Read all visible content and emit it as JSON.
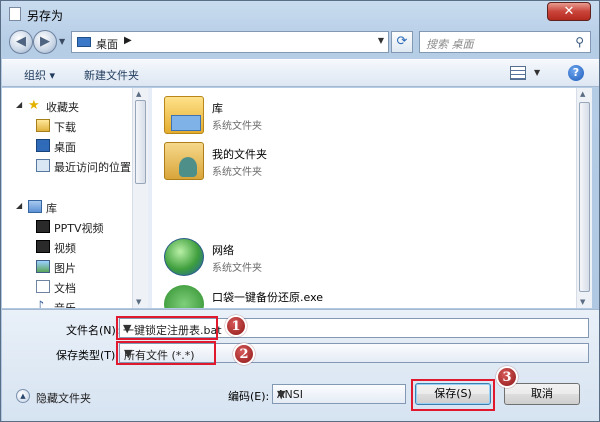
{
  "window": {
    "title": "另存为",
    "close_label": "✕"
  },
  "address": {
    "location": "桌面",
    "chevron": "▶",
    "search_placeholder": "搜索 桌面"
  },
  "toolbar": {
    "organize_label": "组织 ▾",
    "new_folder_label": "新建文件夹",
    "help_label": "?"
  },
  "sidebar": {
    "favorites": {
      "label": "收藏夹",
      "items": [
        {
          "label": "下载",
          "icon": "download-folder-icon"
        },
        {
          "label": "桌面",
          "icon": "desktop-icon"
        },
        {
          "label": "最近访问的位置",
          "icon": "recent-places-icon"
        }
      ]
    },
    "libraries": {
      "label": "库",
      "items": [
        {
          "label": "PPTV视频",
          "icon": "video-library-icon"
        },
        {
          "label": "视频",
          "icon": "video-library-icon"
        },
        {
          "label": "图片",
          "icon": "pictures-library-icon"
        },
        {
          "label": "文档",
          "icon": "documents-library-icon"
        },
        {
          "label": "音乐",
          "icon": "music-library-icon"
        }
      ]
    }
  },
  "files": [
    {
      "name": "库",
      "type": "系统文件夹",
      "icon": "library-folder-icon"
    },
    {
      "name": "我的文件夹",
      "type": "系统文件夹",
      "icon": "user-folder-icon"
    },
    {
      "name": "网络",
      "type": "系统文件夹",
      "icon": "network-globe-icon"
    },
    {
      "name": "口袋一键备份还原.exe",
      "type": "",
      "icon": "exe-app-icon"
    }
  ],
  "form": {
    "filename_label": "文件名(N):",
    "filename_value": "一键锁定注册表.bat",
    "filetype_label": "保存类型(T):",
    "filetype_value": "所有文件 (*.*)",
    "encoding_label": "编码(E):",
    "encoding_value": "ANSI",
    "hide_folders_label": "隐藏文件夹",
    "save_label": "保存(S)",
    "cancel_label": "取消"
  },
  "annotations": {
    "step1": "1",
    "step2": "2",
    "step3": "3",
    "highlight_color": "#e0192e"
  }
}
